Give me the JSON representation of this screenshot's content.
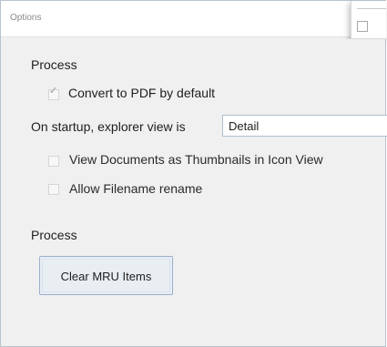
{
  "window": {
    "title": "Options"
  },
  "sections": {
    "process_top": "Process",
    "process_bottom": "Process"
  },
  "options": {
    "convert_pdf": {
      "label": "Convert to PDF by default",
      "checked": true
    },
    "startup_label": "On startup, explorer view is",
    "startup_value": "Detail",
    "thumbnails": {
      "label": "View Documents as Thumbnails in Icon View",
      "checked": false
    },
    "rename": {
      "label": "Allow Filename rename",
      "checked": false
    }
  },
  "buttons": {
    "clear_mru": "Clear MRU Items"
  },
  "icons": {
    "checkbox_checked": "checkbox-checked-icon",
    "checkbox_unchecked": "checkbox-unchecked-icon",
    "dropdown": "dropdown-field"
  },
  "colors": {
    "window_bg": "#f0f0f0",
    "border": "#b9c4cf",
    "title_text": "#8a8a8a",
    "button_border": "#9aaecc"
  }
}
